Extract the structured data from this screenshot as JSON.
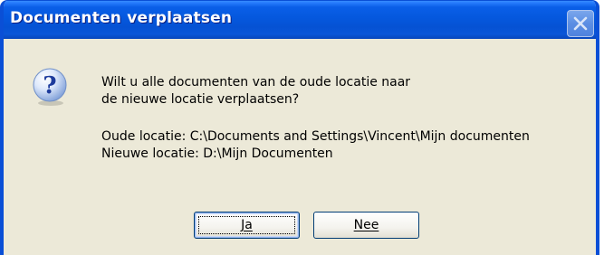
{
  "window": {
    "title": "Documenten verplaatsen",
    "close_icon": "close-icon"
  },
  "dialog": {
    "icon": "question-icon",
    "message_line1": "Wilt u alle documenten van de oude locatie naar",
    "message_line2": "de nieuwe locatie verplaatsen?",
    "old_location_line": "Oude locatie: C:\\Documents and Settings\\Vincent\\Mijn documenten",
    "new_location_line": "Nieuwe locatie: D:\\Mijn Documenten"
  },
  "buttons": {
    "yes_label": "Ja",
    "no_label": "Nee"
  },
  "colors": {
    "titlebar": "#0558de",
    "window_border": "#0a4fd6",
    "dialog_background": "#ece9d8",
    "button_border": "#003c74"
  }
}
